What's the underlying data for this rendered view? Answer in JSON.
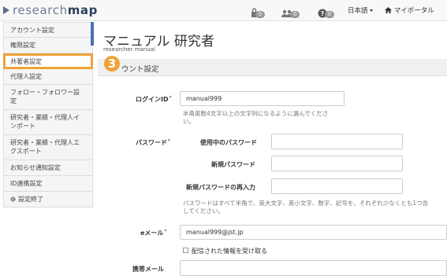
{
  "topbar": {
    "logo_part1": "research",
    "logo_part2": "map",
    "icons": [
      {
        "name": "lock-icon",
        "badge": "0"
      },
      {
        "name": "users-icon",
        "badge": "0"
      },
      {
        "name": "question-icon",
        "badge": "0"
      }
    ],
    "language": "日本語",
    "home_icon": "home-icon",
    "portal": "マイポータル"
  },
  "sidebar": {
    "items": [
      {
        "label": "アカウント設定"
      },
      {
        "label": "権限設定"
      },
      {
        "label": "共著者設定"
      },
      {
        "label": "代理人設定"
      },
      {
        "label": "フォロー・フォロワー設",
        "label2": "定"
      },
      {
        "label": "研究者・業績・代理人イ",
        "label2": "ンポート"
      },
      {
        "label": "研究者・業績・代理人エ",
        "label2": "クスポート"
      },
      {
        "label": "お知らせ通知設定"
      },
      {
        "label": "ID連携設定"
      },
      {
        "label": "設定終了",
        "icon": "gear-icon"
      }
    ]
  },
  "marker": "3",
  "header": {
    "title": "マニュアル 研究者",
    "subtitle": "researcher manual"
  },
  "section": {
    "title": "ウント設定"
  },
  "form": {
    "login_id_label": "ログインID",
    "login_id_value": "manual999",
    "login_id_help1": "半角英数4文字以上の文字列になるように選んでくださ",
    "login_id_help2": "い。",
    "password_label": "パスワード",
    "current_pw_label": "使用中のパスワード",
    "new_pw_label": "新規パスワード",
    "new_pw_confirm_label": "新規パスワードの再入力",
    "pw_help1": "パスワードはすべて半角で、英大文字、英小文字、数字、記号を、それぞれ少なくとも1つ含",
    "pw_help2": "してください。",
    "email_label": "eメール",
    "email_value": "manual999@jst.jp",
    "email_checkbox_label": "配信された情報を受け取る",
    "mobile_label": "携帯メール",
    "required_mark": "*"
  },
  "colors": {
    "highlight": "#f0a23a",
    "accent": "#4a70b3"
  }
}
